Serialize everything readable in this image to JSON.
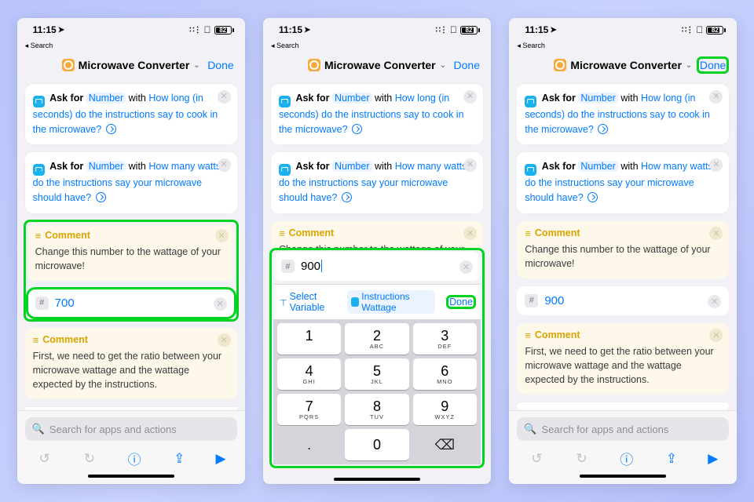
{
  "status": {
    "time": "11:15",
    "loc": "➤",
    "battery": "82"
  },
  "back_label": "Search",
  "nav": {
    "title": "Microwave Converter",
    "done": "Done"
  },
  "ask1": {
    "prefix": "Ask for",
    "type": "Number",
    "with": "with",
    "prompt": "How long (in seconds) do the instructions say to cook in the microwave?"
  },
  "ask2": {
    "prefix": "Ask for",
    "type": "Number",
    "with": "with",
    "prompt": "How many watts do the instructions say your microwave should have?"
  },
  "comment1": {
    "title": "Comment",
    "body": "Change this number to the wattage of your microwave!"
  },
  "comment2": {
    "title": "Comment",
    "body": "First, we need to get the ratio between your microwave wattage and the wattage expected by the instructions."
  },
  "number": {
    "v1": "700",
    "v2": "900",
    "v3": "900"
  },
  "search_placeholder": "Search for apps and actions",
  "accessory": {
    "select_var": "Select Variable",
    "pill": "Instructions Wattage",
    "done": "Done"
  },
  "keys": {
    "k1": "1",
    "k2": "2",
    "k3": "3",
    "k4": "4",
    "k5": "5",
    "k6": "6",
    "k7": "7",
    "k8": "8",
    "k9": "9",
    "k0": "0",
    "dot": ".",
    "s2": "ABC",
    "s3": "DEF",
    "s4": "GHI",
    "s5": "JKL",
    "s6": "MNO",
    "s7": "PQRS",
    "s8": "TUV",
    "s9": "WXYZ"
  }
}
